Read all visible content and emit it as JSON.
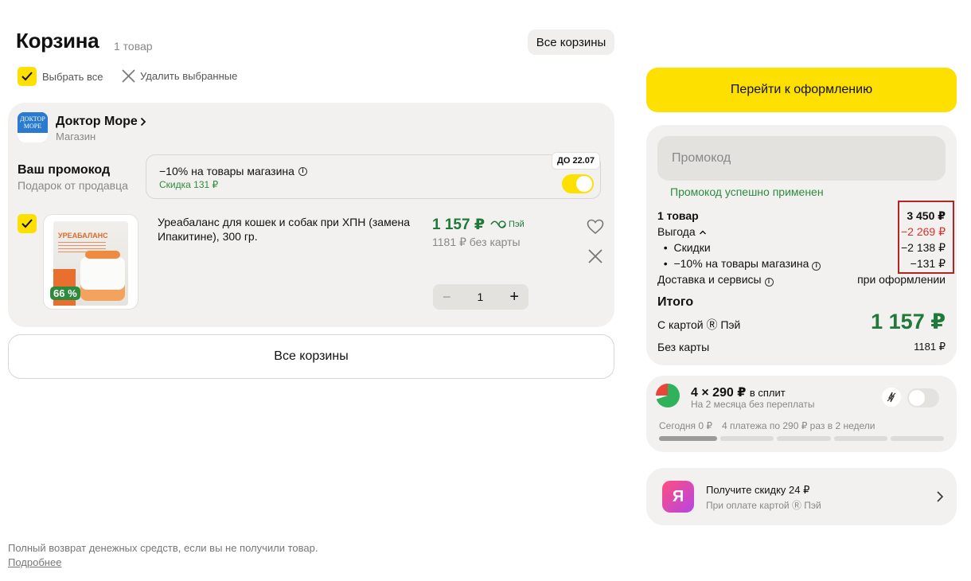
{
  "header": {
    "title": "Корзина",
    "count": "1 товар",
    "all_carts_top": "Все корзины",
    "select_all": "Выбрать все",
    "delete_selected": "Удалить выбранные"
  },
  "shop": {
    "logo_text": "ДОКТОР МОРЕ",
    "name": "Доктор Море",
    "type": "Магазин",
    "promo_label": "Ваш промокод",
    "promo_sub": "Подарок от продавца",
    "promo_title": "−10% на товары магазина",
    "promo_discount": "Скидка 131 ₽",
    "promo_date": "ДО 22.07",
    "item": {
      "name": "Уреабаланс для кошек и собак при ХПН (замена Ипакитине), 300 гр.",
      "image_title": "УРЕАБАЛАНС",
      "image_jar": "100",
      "discount_badge": "66 %",
      "price_card": "1 157 ₽",
      "pay_label": "Пэй",
      "price_no_card": "1181 ₽ без карты",
      "quantity": "1",
      "minus": "−",
      "plus": "+"
    }
  },
  "all_carts_button": "Все корзины",
  "footer": {
    "note": "Полный возврат денежных средств, если вы не получили товар.",
    "link": "Подробнее"
  },
  "checkout": {
    "button": "Перейти к оформлению",
    "promo_placeholder": "Промокод",
    "promo_success": "Промокод успешно применен",
    "rows": {
      "items_label": "1 товар",
      "items_value": "3 450 ₽",
      "benefit_label": "Выгода",
      "benefit_value": "−2 269 ₽",
      "discounts_label": "Скидки",
      "discounts_value": "−2 138 ₽",
      "shop_promo_label": "−10% на товары магазина",
      "shop_promo_value": "−131 ₽",
      "delivery_label": "Доставка и сервисы",
      "delivery_value": "при оформлении"
    },
    "total_title": "Итого",
    "with_card_label": "С картой Ⓡ Пэй",
    "total_price": "1 157 ₽",
    "no_card_label": "Без карты",
    "no_card_value": "1181 ₽"
  },
  "split": {
    "title_amount": "4 × 290 ₽",
    "title_suffix": "в сплит",
    "subtitle": "На 2 месяца без переплаты",
    "today": "Сегодня 0 ₽",
    "plan": "4 платежа по 290 ₽ раз в 2 недели"
  },
  "ya_offer": {
    "logo": "Я",
    "title": "Получите скидку 24 ₽",
    "subtitle": "При оплате картой Ⓡ Пэй"
  },
  "colors": {
    "accent_yellow": "#fddf00",
    "price_green": "#1f7a3a",
    "success_green": "#2e8b3e",
    "benefit_red": "#d9322a",
    "highlight_border": "#b02622"
  }
}
